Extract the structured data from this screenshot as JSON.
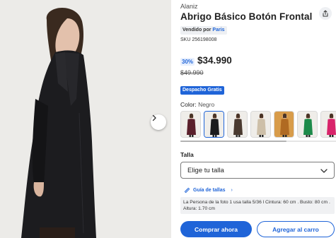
{
  "product": {
    "brand": "Alaniz",
    "title": "Abrigo Básico Botón Frontal",
    "sold_by_prefix": "Vendido por",
    "seller": "Paris",
    "sku": "SKU 256198008",
    "discount": "30%",
    "price": "$34.990",
    "old_price": "$49.990",
    "shipping_badge": "Despacho Gratis"
  },
  "color": {
    "label": "Color:",
    "selected": "Negro",
    "options": [
      {
        "name": "burgundy",
        "coat": "#5a1f2b"
      },
      {
        "name": "black",
        "coat": "#1b1b1d",
        "active": true
      },
      {
        "name": "brown",
        "coat": "#4a3a30"
      },
      {
        "name": "beige",
        "coat": "#cdbfa8"
      },
      {
        "name": "camel",
        "coat": "#b06a22",
        "bg": "#d89c4a"
      },
      {
        "name": "green",
        "coat": "#1d8a4a"
      },
      {
        "name": "pink",
        "coat": "#d8246a"
      }
    ]
  },
  "size": {
    "label": "Talla",
    "placeholder": "Elige tu talla",
    "guide_link": "Guía de tallas",
    "guide_arrow": "›",
    "model_info": "La Persona de la foto 1 usa talla 5/36 l Cintura: 60 cm . Busto: 80 cm . Altura: 1.70 cm"
  },
  "actions": {
    "buy_now": "Comprar ahora",
    "add_to_cart": "Agregar al carro"
  },
  "colors": {
    "accent": "#1f64d8",
    "badge_bg": "#eef0f3"
  },
  "icons": {
    "share": "share-icon",
    "next": "chevron-right-icon",
    "dropdown": "chevron-down-icon",
    "ruler": "ruler-icon"
  }
}
